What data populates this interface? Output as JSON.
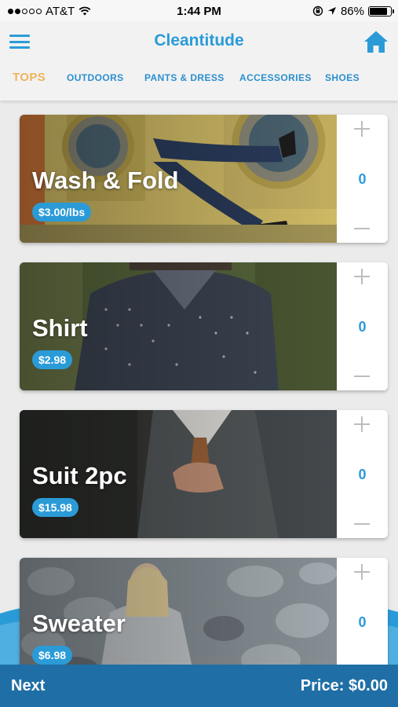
{
  "status_bar": {
    "carrier": "AT&T",
    "time": "1:44 PM",
    "battery": "86%",
    "battery_level": 0.86
  },
  "header": {
    "title": "Cleantitude",
    "menu_icon": "hamburger-menu-icon",
    "home_icon": "home-icon"
  },
  "tabs": [
    {
      "label": "TOPS",
      "active": true
    },
    {
      "label": "OUTDOORS",
      "active": false
    },
    {
      "label": "PANTS & DRESS",
      "active": false
    },
    {
      "label": "ACCESSORIES",
      "active": false
    },
    {
      "label": "SHOES",
      "active": false
    }
  ],
  "items": [
    {
      "name": "Wash & Fold",
      "price": "$3.00/lbs",
      "quantity": "0"
    },
    {
      "name": "Shirt",
      "price": "$2.98",
      "quantity": "0"
    },
    {
      "name": "Suit 2pc",
      "price": "$15.98",
      "quantity": "0"
    },
    {
      "name": "Sweater",
      "price": "$6.98",
      "quantity": "0"
    }
  ],
  "footer": {
    "next_label": "Next",
    "price_label": "Price: $0.00"
  },
  "colors": {
    "accent": "#2b9bd8",
    "active_tab": "#f0b35a",
    "footer": "#1f6fa6"
  }
}
